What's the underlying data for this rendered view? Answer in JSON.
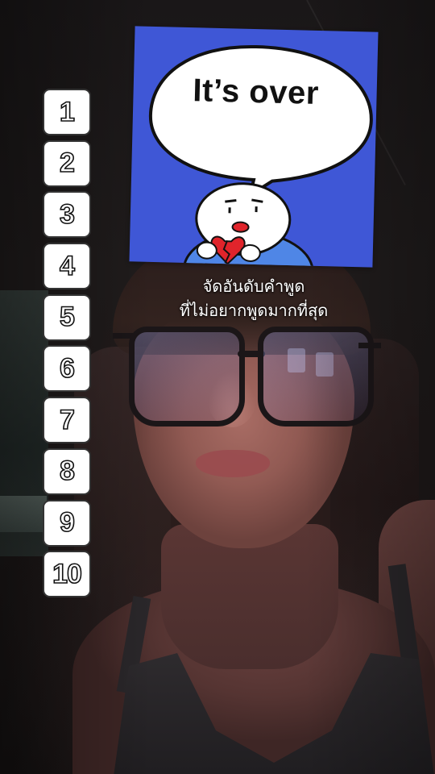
{
  "sticker": {
    "speech_text": "It’s over",
    "background_color": "#3f57d6",
    "character_icon": "heartbroken-character-icon"
  },
  "caption": {
    "line1": "จัดอันดับคำพูด",
    "line2": "ที่ไม่อยากพูดมากที่สุด"
  },
  "ranking": {
    "items": [
      {
        "label": "1"
      },
      {
        "label": "2"
      },
      {
        "label": "3"
      },
      {
        "label": "4"
      },
      {
        "label": "5"
      },
      {
        "label": "6"
      },
      {
        "label": "7"
      },
      {
        "label": "8"
      },
      {
        "label": "9"
      },
      {
        "label": "10"
      }
    ]
  }
}
